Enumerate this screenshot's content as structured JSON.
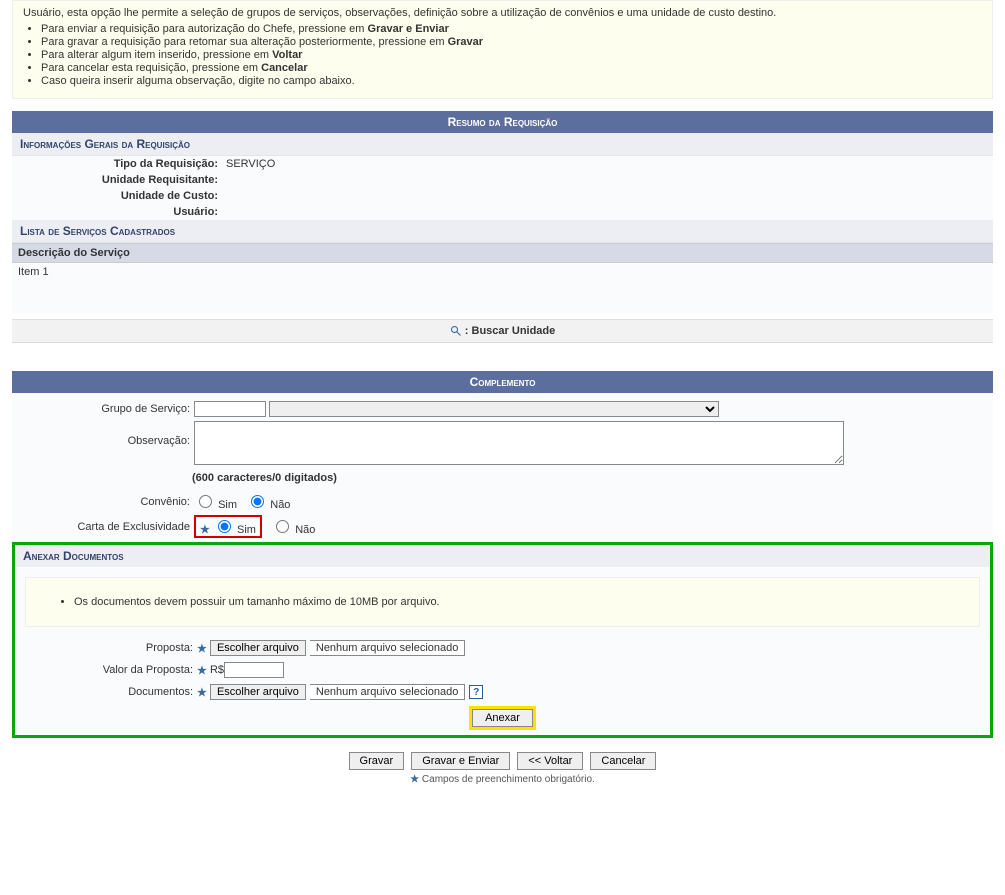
{
  "intro": {
    "lead": "Usuário, esta opção lhe permite a seleção de grupos de serviços, observações, definição sobre a utilização de convênios e uma unidade de custo destino.",
    "items": [
      {
        "prefix": "Para enviar a requisição para autorização do Chefe, pressione em ",
        "bold": "Gravar e Enviar"
      },
      {
        "prefix": "Para gravar a requisição para retomar sua alteração posteriormente, pressione em ",
        "bold": "Gravar"
      },
      {
        "prefix": "Para alterar algum item inserido, pressione em ",
        "bold": "Voltar"
      },
      {
        "prefix": "Para cancelar esta requisição, pressione em ",
        "bold": "Cancelar"
      },
      {
        "prefix": "Caso queira inserir alguma observação, digite no campo abaixo.",
        "bold": ""
      }
    ]
  },
  "resumo": {
    "caption": "Resumo da Requisição",
    "sub1": "Informações Gerais da Requisição",
    "tipo_label": "Tipo da Requisição:",
    "tipo_value": "SERVIÇO",
    "unidade_req_label": "Unidade Requisitante:",
    "unidade_req_value": "",
    "unidade_custo_label": "Unidade de Custo:",
    "unidade_custo_value": "",
    "usuario_label": "Usuário:",
    "usuario_value": "",
    "sub2": "Lista de Serviços Cadastrados",
    "col_header": "Descrição do Serviço",
    "row1": "Item 1",
    "buscar_label": ": Buscar Unidade"
  },
  "complemento": {
    "caption": "Complemento",
    "grupo_label": "Grupo de Serviço:",
    "grupo_code": "",
    "grupo_select": "",
    "obs_label": "Observação:",
    "obs_value": "",
    "char_count": "(600 caracteres/0 digitados)",
    "convenio_label": "Convênio:",
    "convenio_sim": "Sim",
    "convenio_nao": "Não",
    "carta_label": "Carta de Exclusividade",
    "carta_sim": "Sim",
    "carta_nao": "Não"
  },
  "anexar": {
    "caption": "Anexar Documentos",
    "note": "Os documentos devem possuir um tamanho máximo de 10MB por arquivo.",
    "proposta_label": "Proposta:",
    "file_btn": "Escolher arquivo",
    "file_none": "Nenhum arquivo selecionado",
    "valor_label": "Valor da Proposta:",
    "valor_prefix": "R$",
    "valor_value": "",
    "documentos_label": "Documentos:",
    "anexar_btn": "Anexar"
  },
  "actions": {
    "gravar": "Gravar",
    "gravar_enviar": "Gravar e Enviar",
    "voltar": "<< Voltar",
    "cancelar": "Cancelar"
  },
  "footer": {
    "note": "Campos de preenchimento obrigatório."
  }
}
